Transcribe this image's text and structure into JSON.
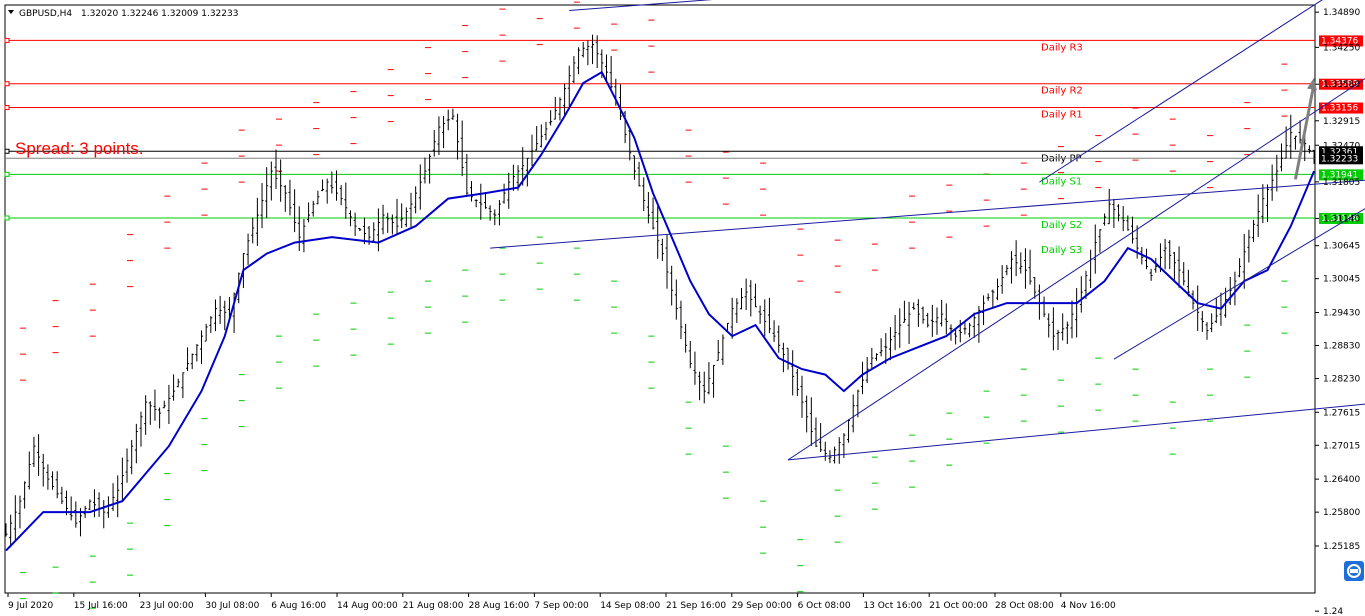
{
  "header": {
    "symbol": "GBPUSD,H4",
    "ohlc": "1.32020 1.32246 1.32009 1.32233"
  },
  "spread_text": "Spread: 3 points.",
  "colors": {
    "candles": "#000000",
    "ma": "#0000cc",
    "trend": "#1a1aa0",
    "resistance": "#ff0000",
    "pivot": "#000000",
    "support": "#00cc00",
    "arrow": "#808080"
  },
  "chart_data": {
    "type": "line",
    "title": "",
    "symbol": "GBPUSD",
    "timeframe": "H4",
    "ylim": [
      1.2433,
      1.3502
    ],
    "y_ticks": [
      "1.34890",
      "1.34250",
      "1.33580",
      "1.32915",
      "1.32470",
      "1.31805",
      "1.31140",
      "1.30645",
      "1.30045",
      "1.29430",
      "1.28830",
      "1.28230",
      "1.27615",
      "1.27015",
      "1.26400",
      "1.25800",
      "1.25185",
      "1.24"
    ],
    "x_ticks": [
      "9 Jul 2020",
      "15 Jul 16:00",
      "23 Jul 00:00",
      "30 Jul 08:00",
      "6 Aug 16:00",
      "14 Aug 00:00",
      "21 Aug 08:00",
      "28 Aug 16:00",
      "7 Sep 00:00",
      "14 Sep 08:00",
      "21 Sep 16:00",
      "29 Sep 00:00",
      "6 Oct 08:00",
      "13 Oct 16:00",
      "21 Oct 00:00",
      "28 Oct 08:00",
      "4 Nov 16:00"
    ],
    "price_path": [
      [
        0,
        1.254
      ],
      [
        3,
        1.26
      ],
      [
        6,
        1.27
      ],
      [
        9,
        1.264
      ],
      [
        12,
        1.26
      ],
      [
        15,
        1.256
      ],
      [
        18,
        1.26
      ],
      [
        21,
        1.258
      ],
      [
        24,
        1.262
      ],
      [
        27,
        1.27
      ],
      [
        30,
        1.278
      ],
      [
        33,
        1.276
      ],
      [
        36,
        1.28
      ],
      [
        39,
        1.285
      ],
      [
        42,
        1.29
      ],
      [
        45,
        1.295
      ],
      [
        48,
        1.294
      ],
      [
        51,
        1.305
      ],
      [
        54,
        1.312
      ],
      [
        57,
        1.32
      ],
      [
        60,
        1.316
      ],
      [
        63,
        1.308
      ],
      [
        66,
        1.314
      ],
      [
        69,
        1.318
      ],
      [
        72,
        1.315
      ],
      [
        75,
        1.31
      ],
      [
        78,
        1.308
      ],
      [
        81,
        1.312
      ],
      [
        84,
        1.31
      ],
      [
        87,
        1.314
      ],
      [
        90,
        1.32
      ],
      [
        93,
        1.328
      ],
      [
        96,
        1.33
      ],
      [
        99,
        1.316
      ],
      [
        102,
        1.314
      ],
      [
        105,
        1.312
      ],
      [
        108,
        1.318
      ],
      [
        111,
        1.321
      ],
      [
        114,
        1.325
      ],
      [
        117,
        1.329
      ],
      [
        120,
        1.335
      ],
      [
        123,
        1.342
      ],
      [
        126,
        1.343
      ],
      [
        129,
        1.338
      ],
      [
        132,
        1.33
      ],
      [
        135,
        1.32
      ],
      [
        138,
        1.312
      ],
      [
        141,
        1.305
      ],
      [
        144,
        1.295
      ],
      [
        147,
        1.285
      ],
      [
        150,
        1.28
      ],
      [
        153,
        1.287
      ],
      [
        156,
        1.295
      ],
      [
        159,
        1.298
      ],
      [
        162,
        1.294
      ],
      [
        165,
        1.29
      ],
      [
        168,
        1.285
      ],
      [
        171,
        1.278
      ],
      [
        174,
        1.27
      ],
      [
        177,
        1.268
      ],
      [
        180,
        1.272
      ],
      [
        183,
        1.28
      ],
      [
        186,
        1.286
      ],
      [
        189,
        1.288
      ],
      [
        192,
        1.292
      ],
      [
        195,
        1.295
      ],
      [
        198,
        1.292
      ],
      [
        201,
        1.294
      ],
      [
        204,
        1.29
      ],
      [
        207,
        1.292
      ],
      [
        210,
        1.296
      ],
      [
        213,
        1.299
      ],
      [
        216,
        1.304
      ],
      [
        219,
        1.302
      ],
      [
        222,
        1.296
      ],
      [
        225,
        1.29
      ],
      [
        228,
        1.292
      ],
      [
        231,
        1.298
      ],
      [
        234,
        1.307
      ],
      [
        237,
        1.314
      ],
      [
        240,
        1.311
      ],
      [
        243,
        1.306
      ],
      [
        246,
        1.301
      ],
      [
        249,
        1.306
      ],
      [
        252,
        1.302
      ],
      [
        255,
        1.296
      ],
      [
        258,
        1.291
      ],
      [
        261,
        1.295
      ],
      [
        264,
        1.3
      ],
      [
        267,
        1.308
      ],
      [
        270,
        1.315
      ],
      [
        273,
        1.32
      ],
      [
        276,
        1.327
      ],
      [
        279,
        1.325
      ],
      [
        281,
        1.3225
      ]
    ],
    "moving_average": [
      [
        0,
        1.251
      ],
      [
        8,
        1.258
      ],
      [
        18,
        1.258
      ],
      [
        25,
        1.26
      ],
      [
        35,
        1.27
      ],
      [
        42,
        1.28
      ],
      [
        47,
        1.29
      ],
      [
        51,
        1.302
      ],
      [
        56,
        1.305
      ],
      [
        62,
        1.307
      ],
      [
        70,
        1.308
      ],
      [
        80,
        1.307
      ],
      [
        88,
        1.31
      ],
      [
        95,
        1.315
      ],
      [
        103,
        1.316
      ],
      [
        110,
        1.317
      ],
      [
        115,
        1.323
      ],
      [
        120,
        1.33
      ],
      [
        124,
        1.336
      ],
      [
        128,
        1.338
      ],
      [
        131,
        1.333
      ],
      [
        135,
        1.326
      ],
      [
        139,
        1.316
      ],
      [
        143,
        1.308
      ],
      [
        147,
        1.3
      ],
      [
        151,
        1.294
      ],
      [
        156,
        1.29
      ],
      [
        161,
        1.292
      ],
      [
        166,
        1.286
      ],
      [
        171,
        1.284
      ],
      [
        176,
        1.283
      ],
      [
        180,
        1.28
      ],
      [
        184,
        1.283
      ],
      [
        190,
        1.286
      ],
      [
        196,
        1.288
      ],
      [
        202,
        1.29
      ],
      [
        208,
        1.294
      ],
      [
        215,
        1.296
      ],
      [
        222,
        1.296
      ],
      [
        230,
        1.296
      ],
      [
        236,
        1.3
      ],
      [
        241,
        1.306
      ],
      [
        246,
        1.304
      ],
      [
        251,
        1.3
      ],
      [
        256,
        1.296
      ],
      [
        261,
        1.295
      ],
      [
        266,
        1.3
      ],
      [
        271,
        1.302
      ],
      [
        276,
        1.31
      ],
      [
        281,
        1.32
      ]
    ],
    "pivot_levels": [
      {
        "label": "Daily R3",
        "tag": "1.34376",
        "value": 1.34376,
        "color": "#ff0000"
      },
      {
        "label": "Daily R2",
        "tag": "1.33589",
        "value": 1.33589,
        "color": "#ff0000"
      },
      {
        "label": "Daily R1",
        "tag": "1.33156",
        "value": 1.33156,
        "color": "#ff0000"
      },
      {
        "label": "Daily PP",
        "tag": "1.32361",
        "value": 1.32361,
        "color": "#000000"
      },
      {
        "label": "Daily S1",
        "tag": "1.31941",
        "value": 1.31941,
        "color": "#00cc00"
      },
      {
        "label": "Daily S2",
        "tag": "1.31148",
        "value": 1.31148,
        "color": "#00cc00"
      },
      {
        "label": "Daily S3",
        "tag": "",
        "value": 1.3069,
        "color": "#00cc00"
      }
    ],
    "current_price_tag": "1.32233",
    "current_price": 1.32233,
    "trend_lines": [
      {
        "from": [
          104,
          1.306
        ],
        "to": [
          305,
          1.3192
        ]
      },
      {
        "from": [
          168,
          1.2675
        ],
        "to": [
          305,
          1.2787
        ]
      },
      {
        "from": [
          168,
          1.2675
        ],
        "to": [
          305,
          1.3441
        ]
      },
      {
        "from": [
          238,
          1.2858
        ],
        "to": [
          305,
          1.3198
        ]
      },
      {
        "from": [
          222,
          1.318
        ],
        "to": [
          288,
          1.354
        ]
      },
      {
        "from": [
          121,
          1.3492
        ],
        "to": [
          195,
          1.354
        ]
      }
    ],
    "arrow": {
      "from": [
        277,
        1.3185
      ],
      "to": [
        281,
        1.337
      ]
    },
    "pivot_dash_rows": {
      "resistance": [
        [
          3,
          1.282
        ],
        [
          10,
          1.287
        ],
        [
          18,
          1.29
        ],
        [
          26,
          1.299
        ],
        [
          34,
          1.306
        ],
        [
          42,
          1.312
        ],
        [
          50,
          1.318
        ],
        [
          58,
          1.32
        ],
        [
          66,
          1.323
        ],
        [
          74,
          1.325
        ],
        [
          82,
          1.329
        ],
        [
          90,
          1.333
        ],
        [
          98,
          1.337
        ],
        [
          106,
          1.34
        ],
        [
          114,
          1.343
        ],
        [
          122,
          1.346
        ],
        [
          130,
          1.342
        ],
        [
          138,
          1.338
        ],
        [
          146,
          1.318
        ],
        [
          154,
          1.314
        ],
        [
          162,
          1.312
        ],
        [
          170,
          1.3
        ],
        [
          178,
          1.298
        ],
        [
          186,
          1.302
        ],
        [
          194,
          1.306
        ],
        [
          202,
          1.308
        ],
        [
          210,
          1.31
        ],
        [
          218,
          1.312
        ],
        [
          226,
          1.315
        ],
        [
          234,
          1.317
        ],
        [
          242,
          1.322
        ],
        [
          250,
          1.32
        ],
        [
          258,
          1.317
        ],
        [
          266,
          1.323
        ],
        [
          274,
          1.33
        ]
      ],
      "support": [
        [
          3,
          1.247
        ],
        [
          10,
          1.248
        ],
        [
          18,
          1.25
        ],
        [
          26,
          1.256
        ],
        [
          34,
          1.265
        ],
        [
          42,
          1.275
        ],
        [
          50,
          1.283
        ],
        [
          58,
          1.29
        ],
        [
          66,
          1.294
        ],
        [
          74,
          1.296
        ],
        [
          82,
          1.298
        ],
        [
          90,
          1.3
        ],
        [
          98,
          1.302
        ],
        [
          106,
          1.306
        ],
        [
          114,
          1.308
        ],
        [
          122,
          1.306
        ],
        [
          130,
          1.3
        ],
        [
          138,
          1.29
        ],
        [
          146,
          1.278
        ],
        [
          154,
          1.27
        ],
        [
          162,
          1.26
        ],
        [
          170,
          1.253
        ],
        [
          178,
          1.262
        ],
        [
          186,
          1.268
        ],
        [
          194,
          1.272
        ],
        [
          202,
          1.276
        ],
        [
          210,
          1.28
        ],
        [
          218,
          1.284
        ],
        [
          226,
          1.282
        ],
        [
          234,
          1.286
        ],
        [
          242,
          1.284
        ],
        [
          250,
          1.278
        ],
        [
          258,
          1.284
        ],
        [
          266,
          1.292
        ],
        [
          274,
          1.3
        ]
      ]
    },
    "candle_count": 282
  }
}
